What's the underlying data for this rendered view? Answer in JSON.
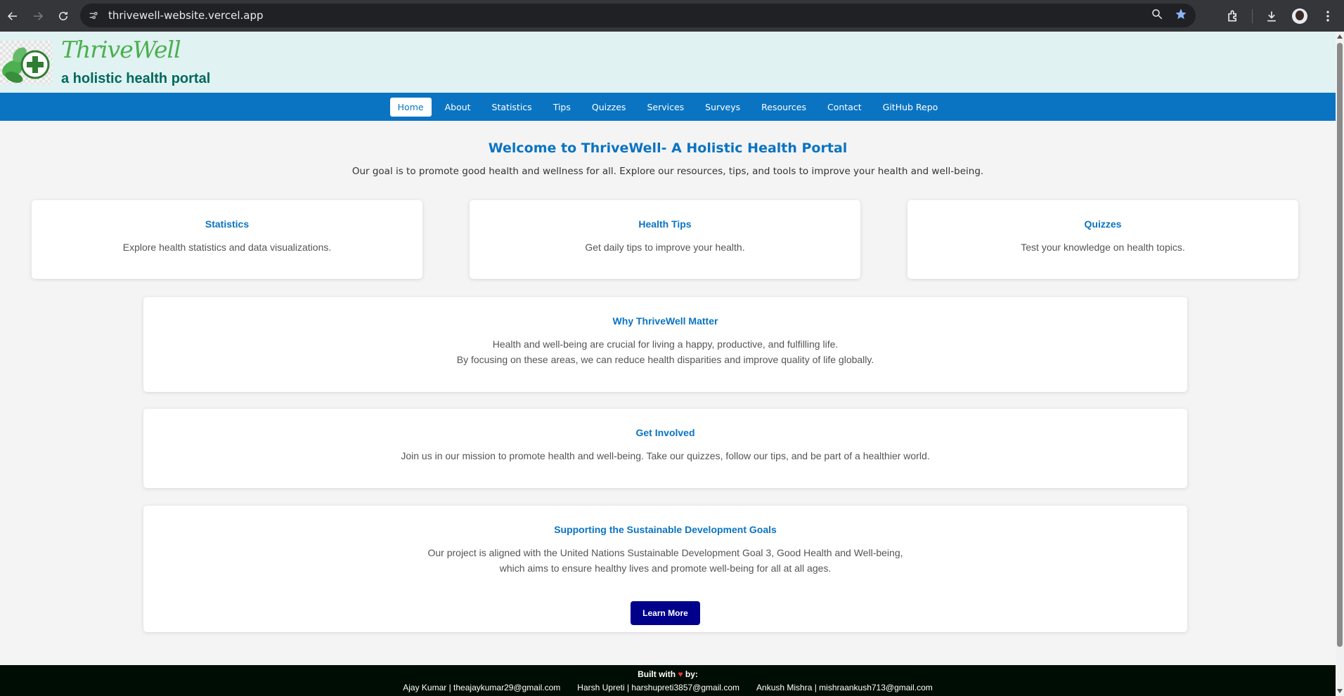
{
  "browser": {
    "url": "thrivewell-website.vercel.app",
    "icons": [
      "back-icon",
      "forward-icon",
      "reload-icon",
      "site-info-icon",
      "zoom-icon",
      "bookmark-star-icon",
      "extensions-icon",
      "download-icon",
      "profile-avatar",
      "menu-icon"
    ]
  },
  "header": {
    "brand": "ThriveWell",
    "tagline": "a holistic health portal"
  },
  "nav": {
    "items": [
      {
        "label": "Home"
      },
      {
        "label": "About"
      },
      {
        "label": "Statistics"
      },
      {
        "label": "Tips"
      },
      {
        "label": "Quizzes"
      },
      {
        "label": "Services"
      },
      {
        "label": "Surveys"
      },
      {
        "label": "Resources"
      },
      {
        "label": "Contact"
      },
      {
        "label": "GitHub Repo"
      }
    ],
    "active": "Home"
  },
  "main": {
    "welcome": "Welcome to ThriveWell- A Holistic Health Portal",
    "intro": "Our goal is to promote good health and wellness for all. Explore our resources, tips, and tools to improve your health and well-being.",
    "feature_cards": [
      {
        "title": "Statistics",
        "text": "Explore health statistics and data visualizations."
      },
      {
        "title": "Health Tips",
        "text": "Get daily tips to improve your health."
      },
      {
        "title": "Quizzes",
        "text": "Test your knowledge on health topics."
      }
    ],
    "why": {
      "title": "Why ThriveWell Matter",
      "line1": "Health and well-being are crucial for living a happy, productive, and fulfilling life.",
      "line2": "By focusing on these areas, we can reduce health disparities and improve quality of life globally."
    },
    "involved": {
      "title": "Get Involved",
      "text": "Join us in our mission to promote health and well-being. Take our quizzes, follow our tips, and be part of a healthier world."
    },
    "sdg": {
      "title": "Supporting the Sustainable Development Goals",
      "line1": "Our project is aligned with the United Nations Sustainable Development Goal 3, Good Health and Well-being,",
      "line2": "which aims to ensure healthy lives and promote well-being for all at all ages.",
      "button": "Learn More"
    }
  },
  "footer": {
    "built_prefix": "Built with",
    "heart": "♥",
    "built_suffix": "by:",
    "credits": [
      "Ajay Kumar | theajaykumar29@gmail.com",
      "Harsh Upreti | harshupreti3857@gmail.com",
      "Ankush Mishra | mishraankush713@gmail.com"
    ]
  },
  "colors": {
    "primary": "#0a74c2",
    "header_bg": "#e0f2f1",
    "brand_green": "#4caf50",
    "tagline_teal": "#00695c",
    "button_navy": "#00008b",
    "footer_bg": "#000d04"
  }
}
